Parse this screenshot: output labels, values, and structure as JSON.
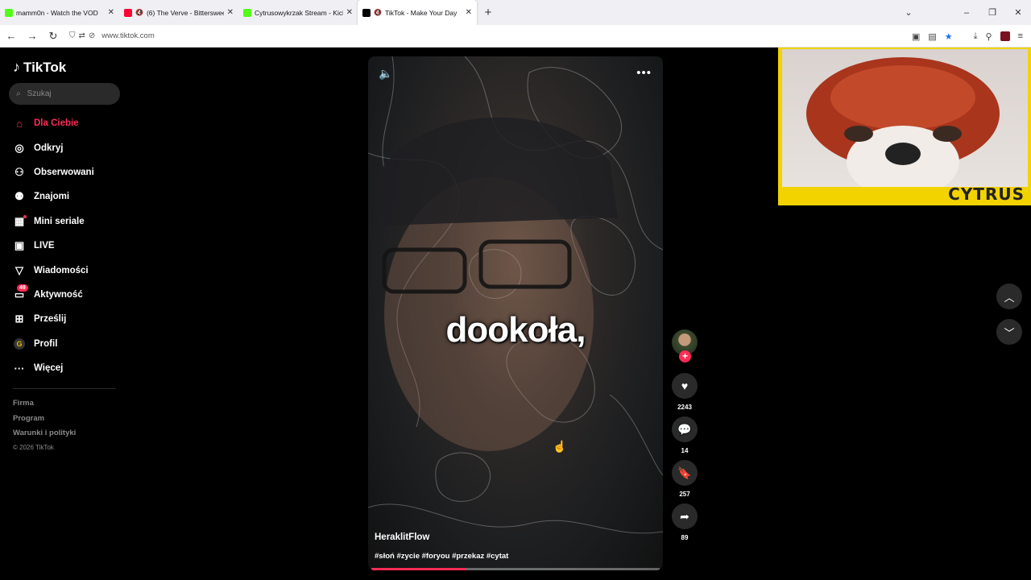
{
  "browser": {
    "tabs": [
      {
        "title": "mamm0n - Watch the VOD",
        "favicon_color": "#53fc18",
        "active": false,
        "muted": false
      },
      {
        "title": "(6) The Verve - Bittersweet",
        "favicon_color": "#ff0033",
        "active": false,
        "muted": true
      },
      {
        "title": "Cytrusowykrzak Stream - Kick D",
        "favicon_color": "#53fc18",
        "active": false,
        "muted": false
      },
      {
        "title": "TikTok - Make Your Day",
        "favicon_color": "#000000",
        "active": true,
        "muted": true
      }
    ],
    "new_tab_glyph": "+",
    "url": "www.tiktok.com"
  },
  "tiktok": {
    "logo_text": "TikTok",
    "search_placeholder": "Szukaj",
    "nav": [
      {
        "label": "Dla Ciebie",
        "icon": "home-icon",
        "active": true
      },
      {
        "label": "Odkryj",
        "icon": "compass-icon"
      },
      {
        "label": "Obserwowani",
        "icon": "following-icon"
      },
      {
        "label": "Znajomi",
        "icon": "friends-icon"
      },
      {
        "label": "Mini seriale",
        "icon": "film-icon"
      },
      {
        "label": "LIVE",
        "icon": "live-icon"
      },
      {
        "label": "Wiadomości",
        "icon": "send-icon"
      },
      {
        "label": "Aktywność",
        "icon": "inbox-icon",
        "badge": "49"
      },
      {
        "label": "Prześlij",
        "icon": "upload-icon"
      },
      {
        "label": "Profil",
        "icon": "profile-avatar-icon"
      },
      {
        "label": "Więcej",
        "icon": "more-dots-icon"
      }
    ],
    "footer": {
      "company": "Firma",
      "program": "Program",
      "terms": "Warunki i polityki",
      "copyright": "© 2026 TikTok"
    },
    "video": {
      "caption_overlay": "dookoła,",
      "author": "HeraklitFlow",
      "hashtags": "#słoń #zycie #foryou #przekaz #cytat",
      "progress": 0.33
    },
    "actions": {
      "likes": "2243",
      "comments": "14",
      "saves": "257",
      "shares": "89"
    }
  },
  "webcam": {
    "label": "CYTRUS",
    "frame_color": "#f2d300"
  },
  "colors": {
    "accent": "#fe2c55",
    "background": "#000000"
  }
}
